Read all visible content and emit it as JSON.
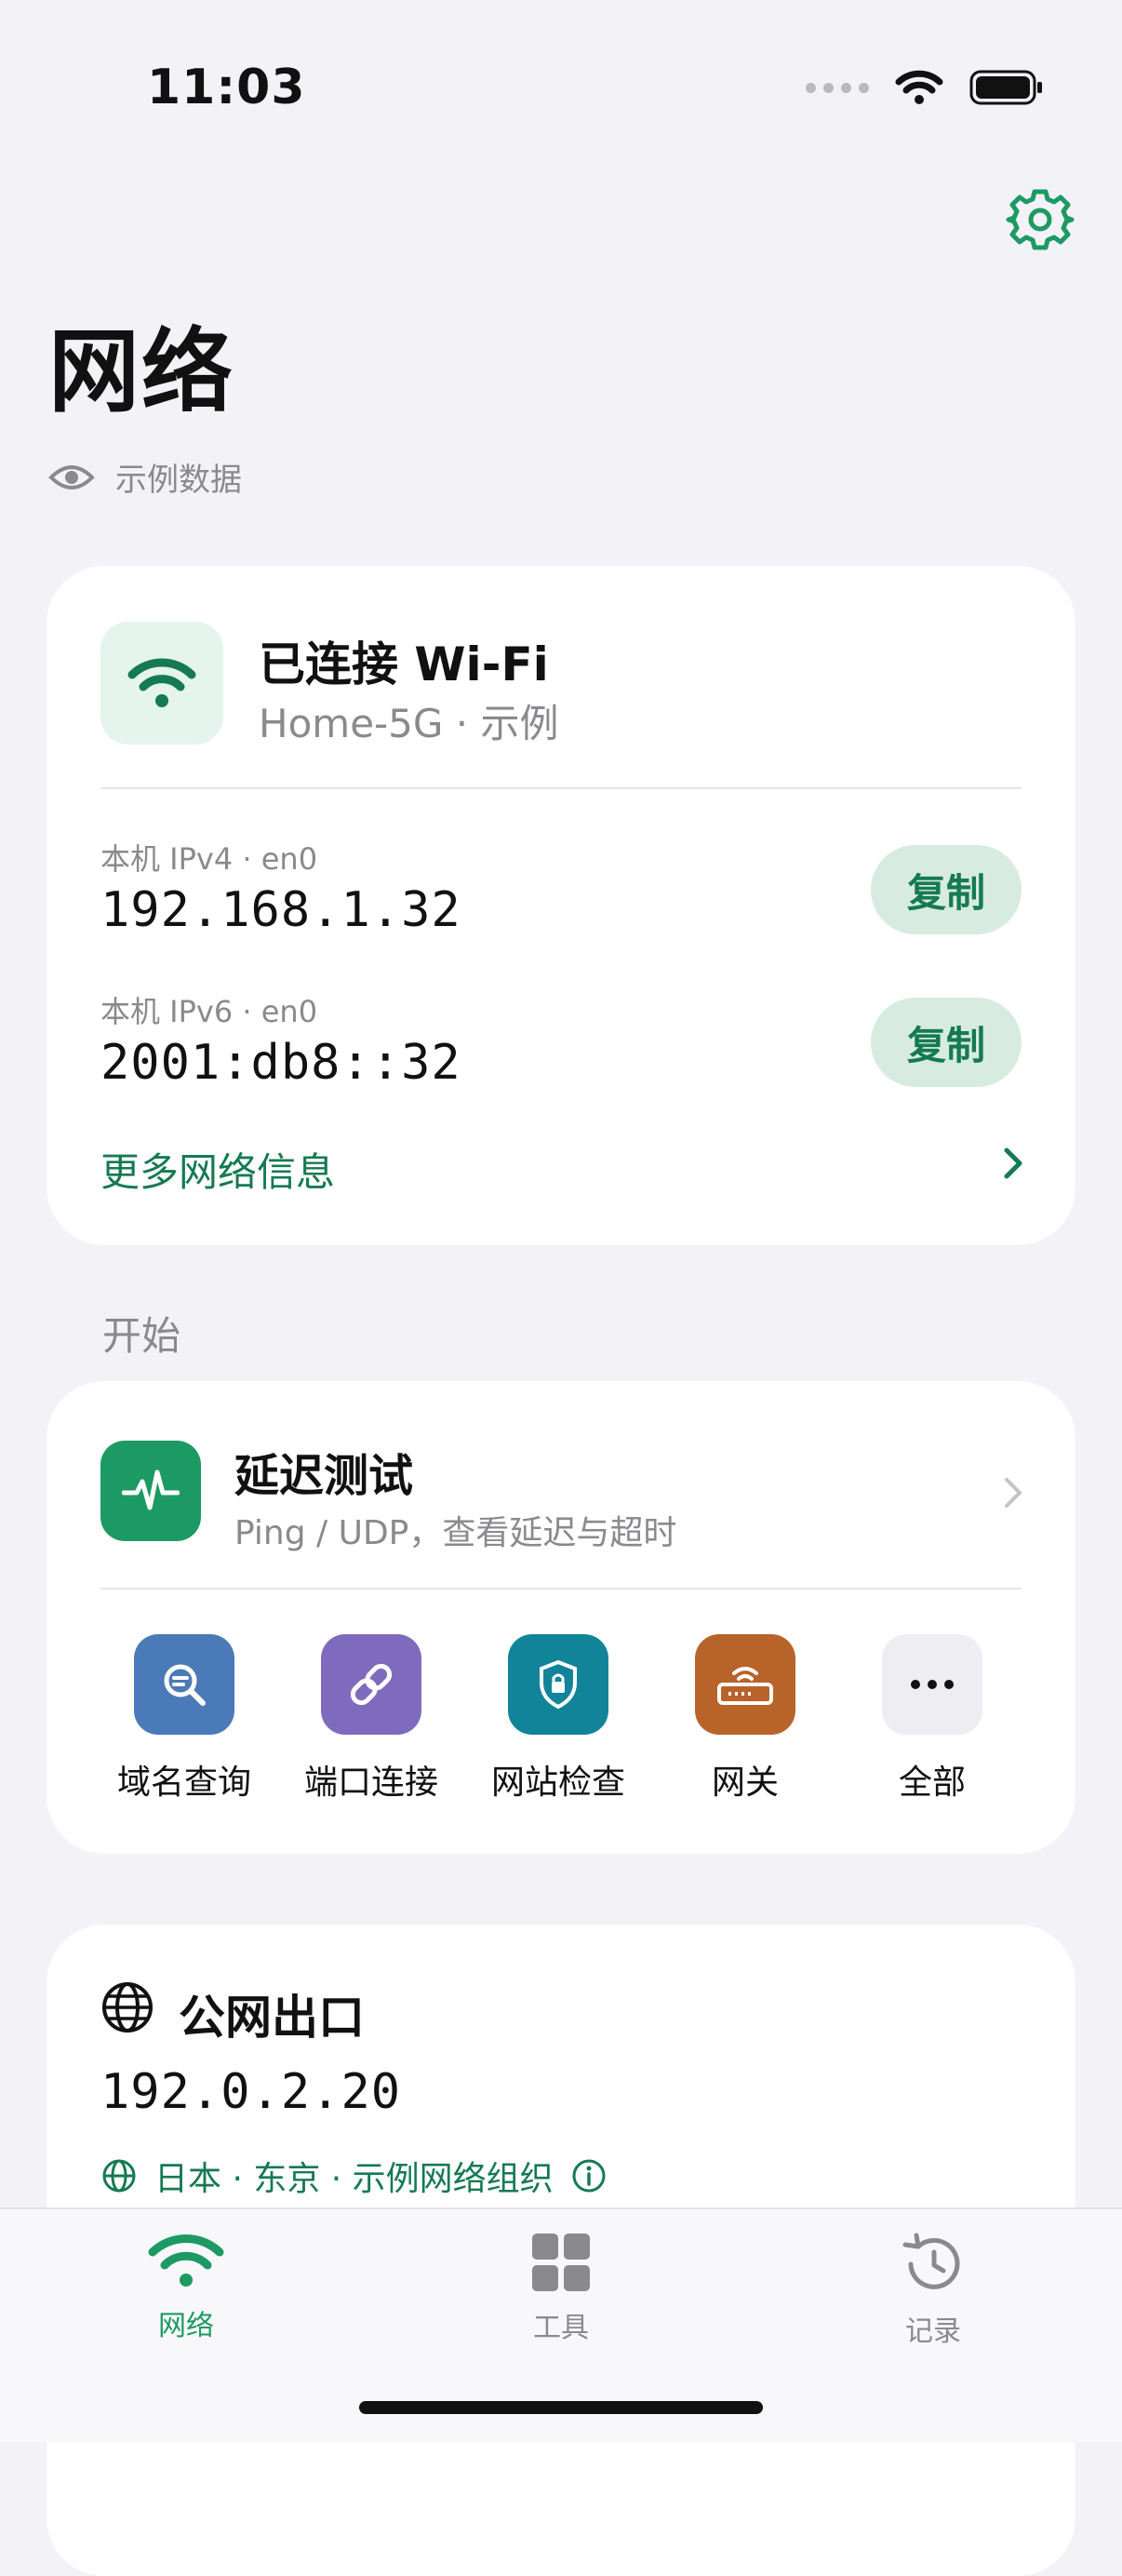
{
  "status_bar": {
    "time": "11:03"
  },
  "header": {
    "title": "网络",
    "sample_label": "示例数据"
  },
  "wifi_card": {
    "title": "已连接 Wi-Fi",
    "subtitle": "Home-5G · 示例",
    "ipv4": {
      "label": "本机 IPv4 · en0",
      "value": "192.168.1.32",
      "button": "复制"
    },
    "ipv6": {
      "label": "本机 IPv6 · en0",
      "value": "2001:db8::32",
      "button": "复制"
    },
    "more_link": "更多网络信息"
  },
  "section_start": {
    "title": "开始"
  },
  "tools_card": {
    "ping": {
      "title": "延迟测试",
      "subtitle": "Ping / UDP，查看延迟与超时"
    },
    "tools": [
      {
        "label": "域名查询",
        "icon": "magnifier-icon",
        "color": "#4a7ab8"
      },
      {
        "label": "端口连接",
        "icon": "link-icon",
        "color": "#7f6bbd"
      },
      {
        "label": "网站检查",
        "icon": "shield-lock-icon",
        "color": "#12849a"
      },
      {
        "label": "网关",
        "icon": "router-icon",
        "color": "#b8632a"
      },
      {
        "label": "全部",
        "icon": "more-icon",
        "color": "#eeeef2"
      }
    ]
  },
  "public_card": {
    "title": "公网出口",
    "ip": "192.0.2.20",
    "location": "日本 · 东京 · 示例网络组织"
  },
  "tab_bar": {
    "tabs": [
      {
        "label": "网络",
        "icon": "wifi-icon",
        "active": true
      },
      {
        "label": "工具",
        "icon": "grid-icon",
        "active": false
      },
      {
        "label": "记录",
        "icon": "history-icon",
        "active": false
      }
    ]
  },
  "colors": {
    "accent": "#157a52",
    "background": "#f2f2f7",
    "active_tab": "#1d9a63",
    "inactive_tab": "#8a8a8e"
  }
}
